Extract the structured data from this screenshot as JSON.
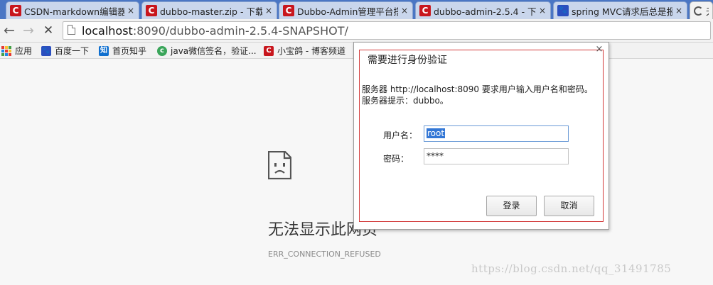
{
  "tabs": [
    {
      "title": "CSDN-markdown编辑器",
      "close": "×",
      "icon": "csdn-icon"
    },
    {
      "title": "dubbo-master.zip - 下载",
      "close": "×",
      "icon": "csdn-icon"
    },
    {
      "title": "Dubbo-Admin管理平台搭",
      "close": "×",
      "icon": "csdn-icon"
    },
    {
      "title": "dubbo-admin-2.5.4 - 下",
      "close": "×",
      "icon": "csdn-icon"
    },
    {
      "title": "spring MVC请求后总是报",
      "close": "×",
      "icon": "baidu-paw-icon"
    },
    {
      "title": "无",
      "icon": "loading-spinner-icon"
    }
  ],
  "toolbar": {
    "back": "←",
    "forward": "→",
    "stop": "✕",
    "url_host": "localhost",
    "url_rest": ":8090/dubbo-admin-2.5.4-SNAPSHOT/"
  },
  "bookmarks": [
    {
      "label": "应用",
      "icon": "apps-grid-icon"
    },
    {
      "label": "百度一下",
      "icon": "baidu-paw-icon"
    },
    {
      "label": "首页知乎",
      "icon": "zhihu-icon",
      "glyph": "知"
    },
    {
      "label": "java微信签名，验证...",
      "icon": "green-c-icon",
      "glyph": "c"
    },
    {
      "label": "小宝鸽 - 博客频道",
      "icon": "csdn-icon",
      "glyph": "C"
    }
  ],
  "error_page": {
    "title": "无法显示此网页",
    "code": "ERR_CONNECTION_REFUSED"
  },
  "watermark": "https://blog.csdn.net/qq_31491785",
  "auth_dialog": {
    "title": "需要进行身份验证",
    "close": "×",
    "message_line1": "服务器 http://localhost:8090 要求用户输入用户名和密码。",
    "message_line2": "服务器提示：dubbo。",
    "username_label": "用户名：",
    "username_value": "root",
    "password_label": "密码：",
    "password_value": "****",
    "login_button": "登录",
    "cancel_button": "取消"
  },
  "colors": {
    "tab_strip": "#4a76c4",
    "csdn_red": "#c8161d",
    "baidu_blue": "#2b4fbf",
    "selection": "#3377d6",
    "dialog_inner_border": "#d23a3a"
  }
}
